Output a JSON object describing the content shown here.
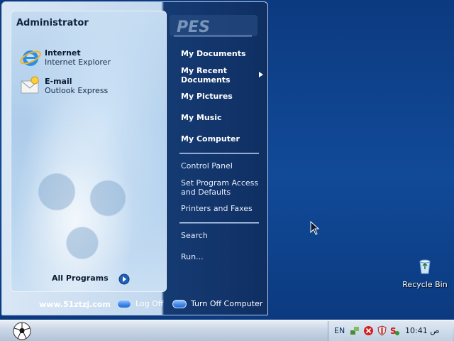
{
  "start_menu": {
    "user_name": "Administrator",
    "pinned": [
      {
        "title": "Internet",
        "subtitle": "Internet Explorer",
        "icon": "internet-explorer-icon"
      },
      {
        "title": "E-mail",
        "subtitle": "Outlook Express",
        "icon": "outlook-express-icon"
      }
    ],
    "all_programs_label": "All Programs",
    "logo_text": "PES",
    "right_items": {
      "my_documents": "My Documents",
      "my_recent_documents_line1": "My Recent",
      "my_recent_documents_line2": "Documents",
      "my_pictures": "My Pictures",
      "my_music": "My Music",
      "my_computer": "My Computer",
      "control_panel": "Control Panel",
      "set_program_access_line1": "Set Program Access",
      "set_program_access_line2": "and Defaults",
      "printers_and_faxes": "Printers and Faxes",
      "search": "Search",
      "run": "Run..."
    },
    "bottom": {
      "site_link": "www.51ztzj.com",
      "log_off": "Log Off",
      "turn_off": "Turn Off Computer"
    }
  },
  "taskbar": {
    "language": "EN",
    "clock": "10:41 ص",
    "tray_icons": [
      "network-icon",
      "error-icon",
      "shield-icon",
      "antivirus-icon"
    ]
  },
  "desktop": {
    "recycle_bin_label": "Recycle Bin"
  },
  "colors": {
    "desktop_blue": "#0f3f86",
    "menu_right_pane": "#153b73",
    "left_pane_light": "#cfe1f3"
  }
}
